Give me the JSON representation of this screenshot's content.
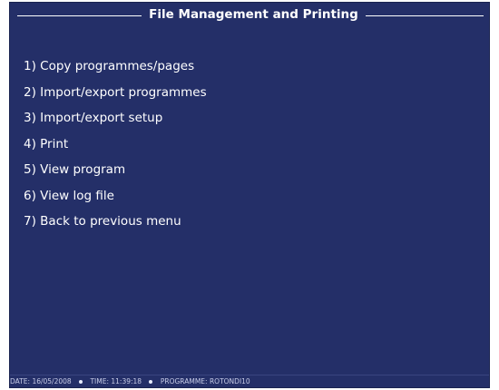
{
  "header": {
    "title": "File Management and Printing"
  },
  "menu": {
    "items": [
      {
        "number": "1",
        "label": "Copy programmes/pages"
      },
      {
        "number": "2",
        "label": "Import/export programmes"
      },
      {
        "number": "3",
        "label": "Import/export setup"
      },
      {
        "number": "4",
        "label": "Print"
      },
      {
        "number": "5",
        "label": "View program"
      },
      {
        "number": "6",
        "label": "View log file"
      },
      {
        "number": "7",
        "label": "Back to previous menu"
      }
    ]
  },
  "status": {
    "date_label": "DATE",
    "date": "16/05/2008",
    "time_label": "TIME",
    "time": "11:39:18",
    "programme_label": "PROGRAMME",
    "programme": "ROTONDI10"
  },
  "colors": {
    "background": "#242f68",
    "text": "#ffffff"
  }
}
